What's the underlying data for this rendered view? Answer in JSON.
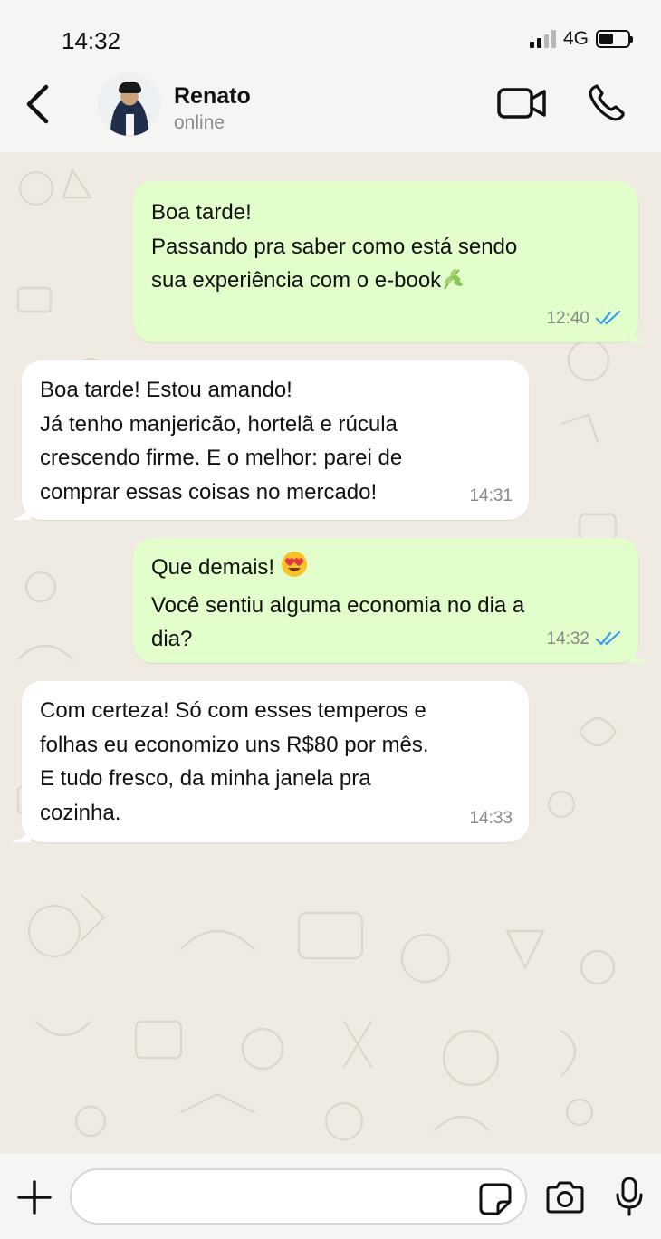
{
  "status_bar": {
    "time": "14:32",
    "network": "4G",
    "battery_level": 0.45,
    "signal_bars": 2
  },
  "header": {
    "contact_name": "Renato",
    "contact_status": "online",
    "back_icon": "chevron-left-icon",
    "video_icon": "video-camera-icon",
    "call_icon": "phone-icon"
  },
  "messages": [
    {
      "direction": "outgoing",
      "text": "Boa tarde!\nPassando pra saber como está sendo\nsua experiência com o e-book",
      "emoji": "🌿",
      "time": "12:40",
      "read": true
    },
    {
      "direction": "incoming",
      "text": "Boa tarde! Estou amando!\nJá tenho manjericão, hortelã e rúcula\ncrescendo firme. E o melhor: parei de\ncomprar essas coisas no mercado!",
      "time": "14:31"
    },
    {
      "direction": "outgoing",
      "text_before": "Que demais! ",
      "emoji": "😍",
      "text_after": "\nVocê sentiu alguma economia no dia a\ndia?",
      "time": "14:32",
      "read": true
    },
    {
      "direction": "incoming",
      "text": "Com certeza! Só com esses temperos e\nfolhas eu economizo uns R$80 por mês.\nE tudo fresco, da minha janela pra\ncozinha.",
      "time": "14:33"
    }
  ],
  "composer": {
    "placeholder": "",
    "plus_icon": "plus-icon",
    "sticker_icon": "sticker-icon",
    "camera_icon": "camera-icon",
    "mic_icon": "microphone-icon"
  },
  "colors": {
    "outgoing_bubble": "#e1fecb",
    "incoming_bubble": "#ffffff",
    "read_ticks": "#3b9bf0",
    "chat_background": "#efeae2"
  }
}
